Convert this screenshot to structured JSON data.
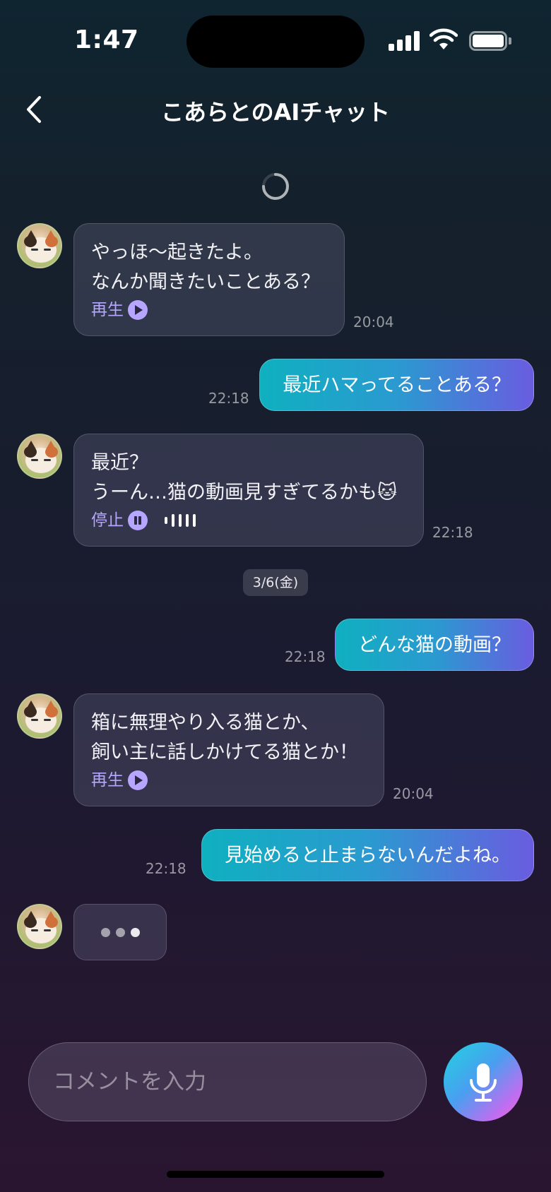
{
  "status_bar": {
    "time": "1:47"
  },
  "nav": {
    "title": "こあらとのAIチャット"
  },
  "messages": [
    {
      "sender": "ai",
      "lines": [
        "やっほ〜起きたよ。",
        "なんか聞きたいことある？"
      ],
      "audio_label": "再生",
      "audio_state": "play",
      "time": "20:04"
    },
    {
      "sender": "me",
      "text": "最近ハマってることある？",
      "time": "22:18"
    },
    {
      "sender": "ai",
      "lines": [
        "最近？",
        "うーん…猫の動画見すぎてるかも🐱"
      ],
      "audio_label": "停止",
      "audio_state": "playing",
      "time": "22:18"
    },
    {
      "sender": "me",
      "text": "どんな猫の動画？",
      "time": "22:18"
    },
    {
      "sender": "ai",
      "lines": [
        "箱に無理やり入る猫とか、",
        "飼い主に話しかけてる猫とか！"
      ],
      "audio_label": "再生",
      "audio_state": "play",
      "time": "20:04"
    },
    {
      "sender": "me",
      "text": "見始めると止まらないんだよね。",
      "time": "22:18"
    }
  ],
  "date_divider": "3/6(金)",
  "input": {
    "placeholder": "コメントを入力"
  },
  "colors": {
    "accent": "#b7a6ff",
    "user_bubble_start": "#0fb0c0",
    "user_bubble_end": "#6a5ce0"
  }
}
